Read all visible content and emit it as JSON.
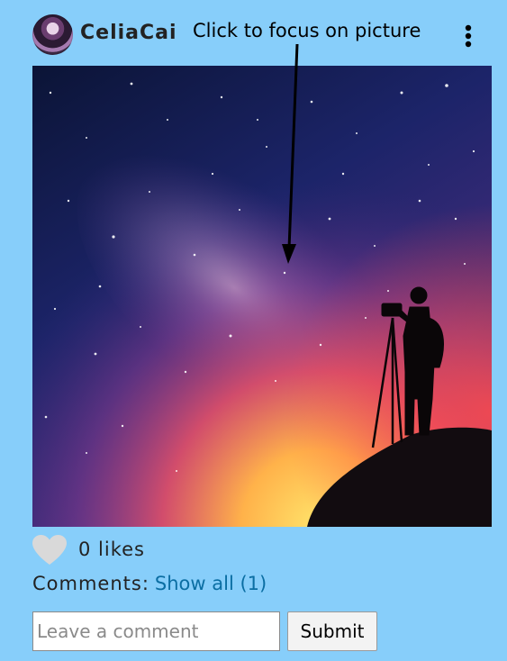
{
  "post": {
    "username": "CeliaCai",
    "annotation": "Click to focus on picture",
    "likes_text": "0 likes",
    "comments_label": "Comments:",
    "show_all_label": "Show all (1)",
    "comment_placeholder": "Leave a comment",
    "submit_label": "Submit"
  },
  "icons": {
    "menu": "more-vertical-icon",
    "like": "heart-icon"
  },
  "colors": {
    "background": "#87cefa",
    "link": "#0b6ea3",
    "heart": "#d9d9d9"
  }
}
